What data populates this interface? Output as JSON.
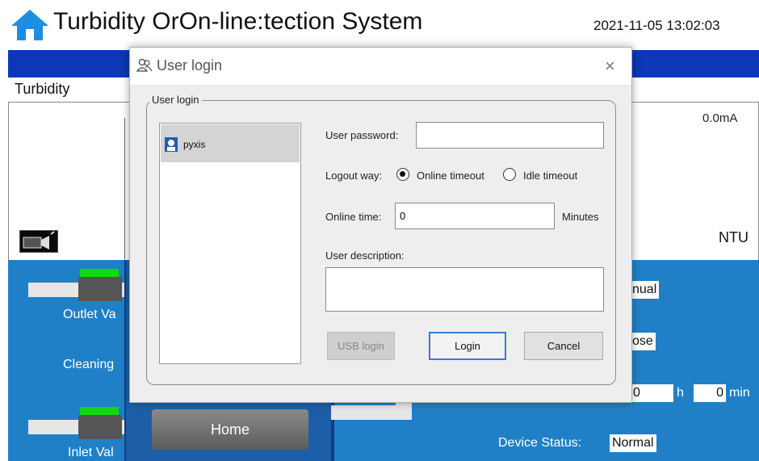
{
  "app": {
    "title": "Turbidity OrOn-line:tection System",
    "datetime": "2021-11-05 13:02:03",
    "turbidity_label": "Turbidity",
    "current_reading": "0.0mA",
    "unit": "NTU",
    "outlet_valve_label": "Outlet Va",
    "cleaning_label": "Cleaning",
    "inlet_valve_label": "Inlet Val",
    "mode_value": "nual",
    "valve_state_value": "ose",
    "hours_value": "0",
    "hours_unit": "h",
    "minutes_value": "0",
    "minutes_unit": "min",
    "device_status_label": "Device Status:",
    "device_status_value": "Normal",
    "home_button_label": "Home",
    "colors": {
      "band_blue": "#0c38b8",
      "panel_blue": "#1f80c8",
      "valve_green": "#10d810"
    }
  },
  "dialog": {
    "title": "User login",
    "close_glyph": "×",
    "group_label": "User login",
    "users": [
      {
        "name": "pyxis"
      }
    ],
    "password_label": "User password:",
    "password_value": "",
    "logout_label": "Logout way:",
    "logout_options": [
      "Online timeout",
      "Idle timeout"
    ],
    "logout_selected": "Online timeout",
    "online_time_label": "Online time:",
    "online_time_value": "0",
    "online_time_unit": "Minutes",
    "description_label": "User description:",
    "description_value": "",
    "usb_login_label": "USB login",
    "login_label": "Login",
    "cancel_label": "Cancel"
  }
}
